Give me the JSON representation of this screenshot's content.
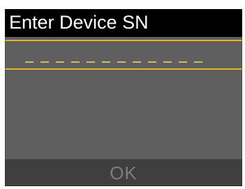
{
  "screen": {
    "title": "Enter Device SN"
  },
  "serial_entry": {
    "slot_count": 12
  },
  "actions": {
    "ok_label": "OK"
  },
  "colors": {
    "screen_bg": "#5f5f5f",
    "title_bg": "#000000",
    "accent": "#e7b21b",
    "bottom_bar": "#3f3f3f",
    "ok_text": "#7d7d7d"
  }
}
